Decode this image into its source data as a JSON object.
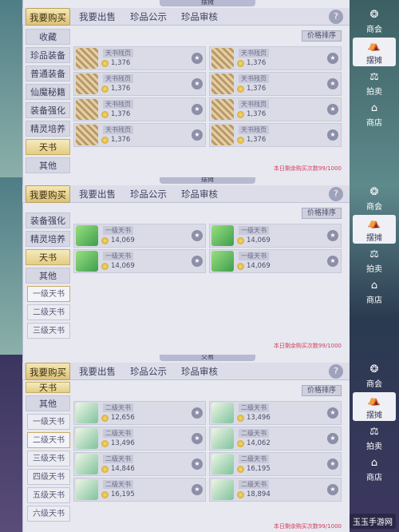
{
  "top_tabs": [
    "我要购买",
    "我要出售",
    "珍品公示",
    "珍品审核"
  ],
  "help": "?",
  "sort_label": "价格排序",
  "limit_note": "本日剩余购买次数99/1000",
  "right_nav": [
    {
      "label": "商会",
      "icon": "❂"
    },
    {
      "label": "摆摊",
      "icon": "⛺"
    },
    {
      "label": "拍卖",
      "icon": "⚖"
    },
    {
      "label": "商店",
      "icon": "⌂"
    }
  ],
  "panel1": {
    "title": "摆摊",
    "sidebar": [
      "收藏",
      "珍品装备",
      "普通装备",
      "仙魔秘籍",
      "装备强化",
      "精灵培养",
      "天书",
      "其他"
    ],
    "items": [
      {
        "name": "天书残页",
        "price": "1,376"
      },
      {
        "name": "天书残页",
        "price": "1,376"
      },
      {
        "name": "天书残页",
        "price": "1,376"
      },
      {
        "name": "天书残页",
        "price": "1,376"
      },
      {
        "name": "天书残页",
        "price": "1,376"
      },
      {
        "name": "天书残页",
        "price": "1,376"
      },
      {
        "name": "天书残页",
        "price": "1,376"
      },
      {
        "name": "天书残页",
        "price": "1,376"
      }
    ]
  },
  "panel2": {
    "title": "摆摊",
    "sidebar": [
      "装备强化",
      "精灵培养",
      "天书",
      "其他",
      "一级天书",
      "二级天书",
      "三级天书"
    ],
    "items": [
      {
        "name": "一级天书",
        "price": "14,069"
      },
      {
        "name": "一级天书",
        "price": "14,069"
      },
      {
        "name": "一级天书",
        "price": "14,069"
      },
      {
        "name": "一级天书",
        "price": "14,069"
      }
    ]
  },
  "panel3": {
    "title": "交易",
    "sidebar": [
      "天书",
      "其他",
      "一级天书",
      "二级天书",
      "三级天书",
      "四级天书",
      "五级天书",
      "六级天书"
    ],
    "items": [
      {
        "name": "二级天书",
        "price": "12,656"
      },
      {
        "name": "二级天书",
        "price": "13,496"
      },
      {
        "name": "二级天书",
        "price": "13,496"
      },
      {
        "name": "二级天书",
        "price": "14,062"
      },
      {
        "name": "二级天书",
        "price": "14,846"
      },
      {
        "name": "二级天书",
        "price": "16,195"
      },
      {
        "name": "二级天书",
        "price": "16,195"
      },
      {
        "name": "二级天书",
        "price": "18,894"
      }
    ]
  },
  "watermark": "玉玉手游网"
}
